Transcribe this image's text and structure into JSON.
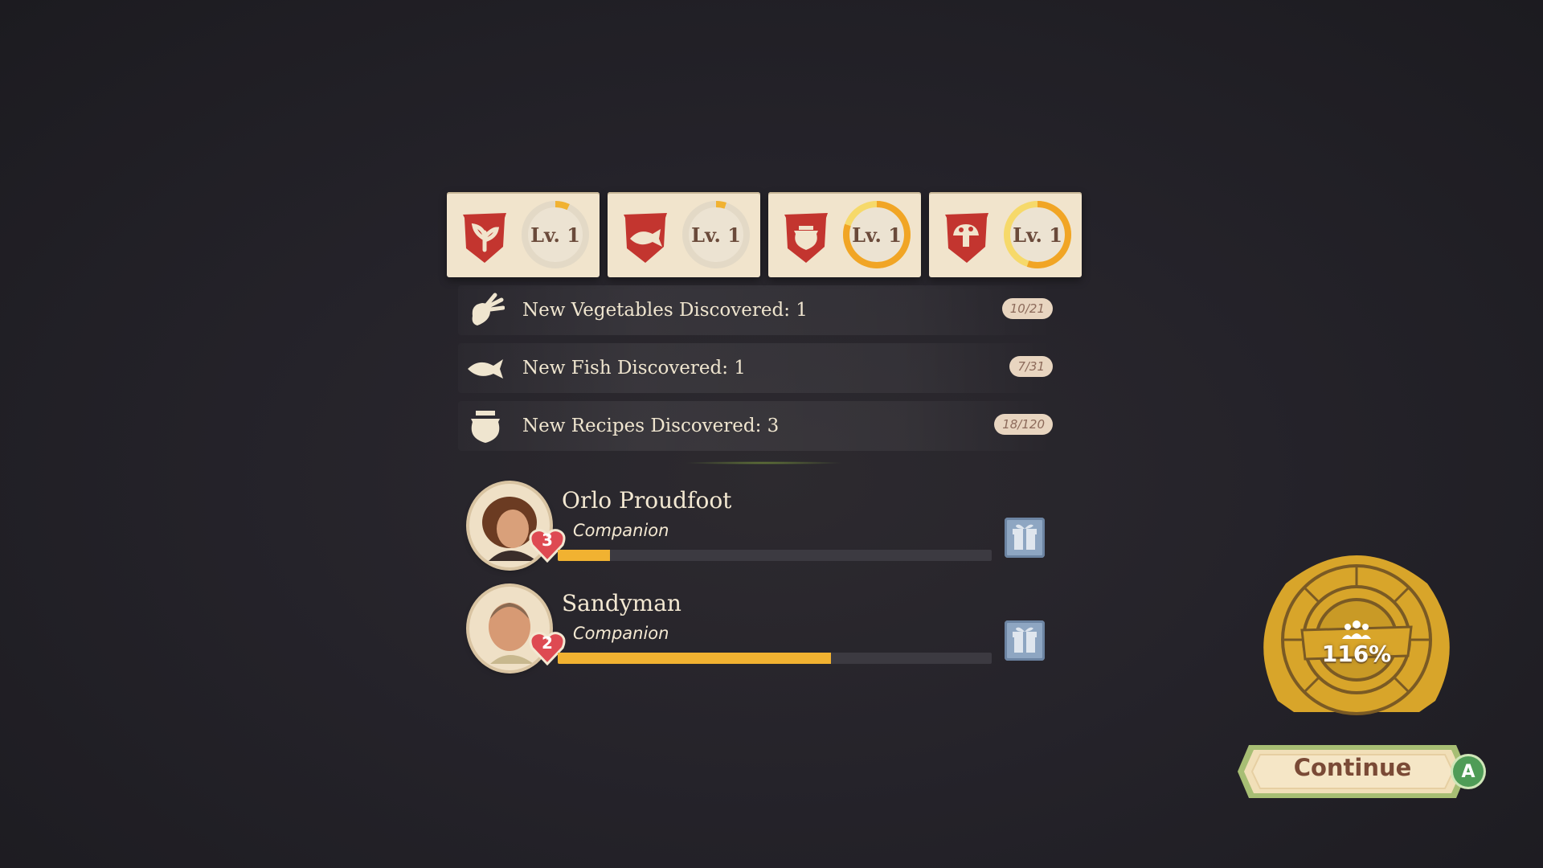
{
  "skills": [
    {
      "icon": "vegetable-icon",
      "level": "Lv. 1",
      "progress": 0.07
    },
    {
      "icon": "fish-icon",
      "level": "Lv. 1",
      "progress": 0.05
    },
    {
      "icon": "cooking-pot-icon",
      "level": "Lv. 1",
      "progress": 0.8
    },
    {
      "icon": "mushroom-icon",
      "level": "Lv. 1",
      "progress": 0.55
    }
  ],
  "discoveries": [
    {
      "label": "New Vegetables Discovered: 1",
      "count": "10/21",
      "icon": "vegetable-icon"
    },
    {
      "label": "New Fish Discovered: 1",
      "count": "7/31",
      "icon": "fish-icon"
    },
    {
      "label": "New Recipes Discovered: 3",
      "count": "18/120",
      "icon": "cooking-pot-icon"
    }
  ],
  "companions": [
    {
      "name": "Orlo Proudfoot",
      "role": "Companion",
      "hearts": "3",
      "progress": 0.12
    },
    {
      "name": "Sandyman",
      "role": "Companion",
      "hearts": "2",
      "progress": 0.63
    }
  ],
  "badge": {
    "percent": "116%",
    "icon": "people-icon"
  },
  "continue": {
    "label": "Continue",
    "key": "A"
  },
  "colors": {
    "card": "#f1e4cc",
    "banner": "#c3352f",
    "ring": "#f1b231",
    "bar": "#f1b231",
    "background": "#25232a"
  }
}
